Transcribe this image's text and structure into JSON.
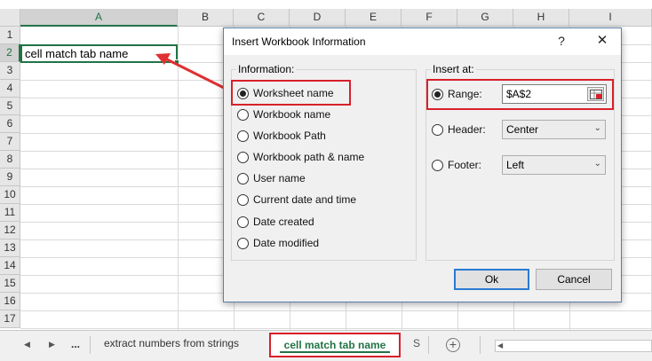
{
  "spreadsheet": {
    "columns": [
      "A",
      "B",
      "C",
      "D",
      "E",
      "F",
      "G",
      "H",
      "I"
    ],
    "rows": [
      "1",
      "2",
      "3",
      "4",
      "5",
      "6",
      "7",
      "8",
      "9",
      "10",
      "11",
      "12",
      "13",
      "14",
      "15",
      "16",
      "17"
    ],
    "selected_column": "A",
    "selected_row": "2",
    "cell_a2_value": "cell match tab name"
  },
  "dialog": {
    "title": "Insert Workbook Information",
    "help_label": "?",
    "close_label": "✕",
    "information_group": {
      "label": "Information:",
      "options": [
        {
          "label": "Worksheet name",
          "selected": true
        },
        {
          "label": "Workbook name",
          "selected": false
        },
        {
          "label": "Workbook Path",
          "selected": false
        },
        {
          "label": "Workbook path & name",
          "selected": false
        },
        {
          "label": "User name",
          "selected": false
        },
        {
          "label": "Current date and time",
          "selected": false
        },
        {
          "label": "Date created",
          "selected": false
        },
        {
          "label": "Date modified",
          "selected": false
        }
      ]
    },
    "insert_group": {
      "label": "Insert at:",
      "range": {
        "label": "Range:",
        "value": "$A$2",
        "selected": true
      },
      "header": {
        "label": "Header:",
        "value": "Center",
        "selected": false
      },
      "footer": {
        "label": "Footer:",
        "value": "Left",
        "selected": false
      }
    },
    "ok_label": "Ok",
    "cancel_label": "Cancel"
  },
  "tabbar": {
    "prev_label": "◀",
    "next_label": "▶",
    "more_label": "...",
    "tabs": [
      {
        "label": "extract numbers from strings",
        "active": false
      },
      {
        "label": "cell match tab name",
        "active": true
      },
      {
        "label": "S",
        "active": false
      }
    ],
    "add_sheet_label": "+"
  },
  "colors": {
    "excel_green": "#217346",
    "highlight_red": "#d8202b",
    "default_button_blue": "#2a7ad2"
  }
}
